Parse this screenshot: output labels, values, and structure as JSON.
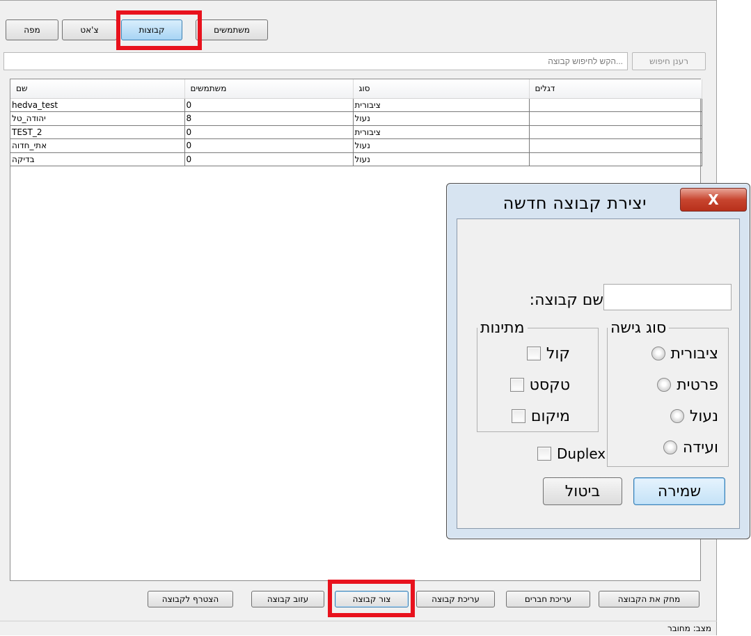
{
  "tabs": [
    {
      "label": "משתמשים"
    },
    {
      "label": "קבוצות"
    },
    {
      "label": "צ'אט"
    },
    {
      "label": "מפה"
    }
  ],
  "search": {
    "placeholder": "...הקש לחיפוש קבוצה",
    "refresh_label": "רענן חיפוש"
  },
  "table": {
    "columns": [
      "שם",
      "משתמשים",
      "סוג",
      "דגלים"
    ],
    "rows": [
      {
        "name": "hedva_test",
        "users": "0",
        "type": "ציבורית",
        "flags": ""
      },
      {
        "name": "יהודה_טל",
        "users": "8",
        "type": "נעול",
        "flags": ""
      },
      {
        "name": "TEST_2",
        "users": "0",
        "type": "ציבורית",
        "flags": ""
      },
      {
        "name": "אתי_חדוה",
        "users": "0",
        "type": "נעול",
        "flags": ""
      },
      {
        "name": "בדיקה",
        "users": "0",
        "type": "נעול",
        "flags": ""
      }
    ]
  },
  "bottom_buttons": {
    "join": "הצטרף לקבוצה",
    "leave": "עזוב קבוצה",
    "create": "צור קבוצה",
    "edit": "עריכת קבוצה",
    "edit_members": "עריכת חברים",
    "delete": "מחק את הקבוצה"
  },
  "status": "מצב: מחובר",
  "dialog": {
    "title": "יצירת קבוצה חדשה",
    "close_glyph": "X",
    "name_label": "שם קבוצה:",
    "name_value": "",
    "features_legend": "מתינות",
    "features": [
      {
        "label": "קול",
        "checked": false
      },
      {
        "label": "טקסט",
        "checked": false
      },
      {
        "label": "מיקום",
        "checked": false
      }
    ],
    "access_legend": "סוג גישה",
    "access_options": [
      {
        "label": "ציבורית",
        "selected": false
      },
      {
        "label": "פרטית",
        "selected": false
      },
      {
        "label": "נעול",
        "selected": false
      },
      {
        "label": "ועידה",
        "selected": false
      }
    ],
    "duplex_label": "Duplex",
    "duplex_checked": false,
    "save_label": "שמירה",
    "cancel_label": "ביטול"
  },
  "colors": {
    "highlight": "#e8121d",
    "active_tab": "#a7d4f4",
    "dialog_frame": "#d7e4f1"
  }
}
